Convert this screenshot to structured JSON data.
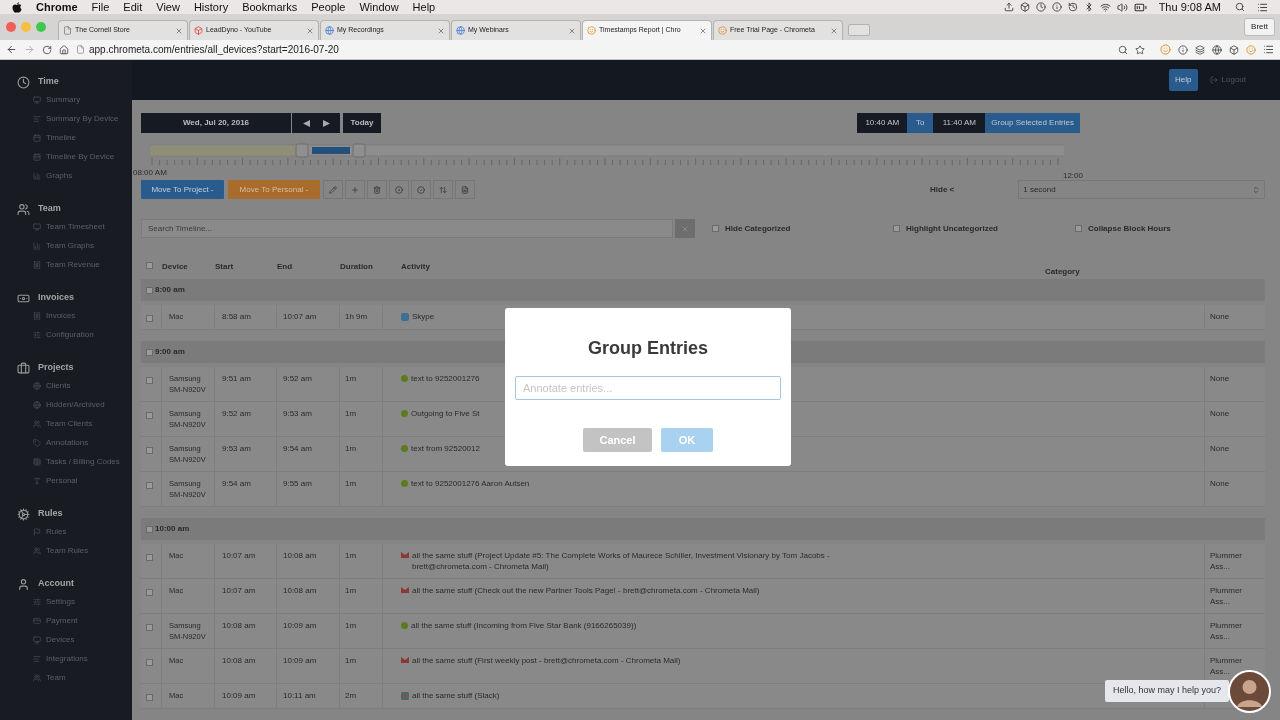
{
  "menubar": {
    "app": "Chrome",
    "menus": [
      "File",
      "Edit",
      "View",
      "History",
      "Bookmarks",
      "People",
      "Window",
      "Help"
    ],
    "clock": "Thu 9:08 AM"
  },
  "browser": {
    "tabs": [
      {
        "title": "The Cornell Store",
        "selected": false
      },
      {
        "title": "LeadDyno - YouTube",
        "selected": false
      },
      {
        "title": "My Recordings",
        "selected": false
      },
      {
        "title": "My Webinars",
        "selected": false
      },
      {
        "title": "Timestamps Report | Chro",
        "selected": true
      },
      {
        "title": "Free Trial Page - Chrometa",
        "selected": false
      }
    ],
    "profile": "Brett",
    "url": "app.chrometa.com/entries/all_devices?start=2016-07-20"
  },
  "header": {
    "help": "Help",
    "logout": "Logout"
  },
  "sidebar": [
    {
      "title": "Time",
      "items": [
        "Summary",
        "Summary By Device",
        "Timeline",
        "Timeline By Device",
        "Graphs"
      ]
    },
    {
      "title": "Team",
      "items": [
        "Team Timesheet",
        "Team Graphs",
        "Team Revenue"
      ]
    },
    {
      "title": "Invoices",
      "items": [
        "Invoices",
        "Configuration"
      ]
    },
    {
      "title": "Projects",
      "items": [
        "Clients",
        "Hidden/Archived",
        "Team Clients",
        "Annotations",
        "Tasks / Billing Codes",
        "Personal"
      ]
    },
    {
      "title": "Rules",
      "items": [
        "Rules",
        "Team Rules"
      ]
    },
    {
      "title": "Account",
      "items": [
        "Settings",
        "Payment",
        "Devices",
        "Integrations",
        "Team"
      ]
    }
  ],
  "toolbar": {
    "date": "Wed, Jul 20, 2016",
    "today": "Today",
    "from": "10:40 AM",
    "to_label": "To",
    "to": "11:40 AM",
    "group": "Group Selected Entries",
    "move_project": "Move To Project -",
    "move_personal": "Move To Personal -",
    "hide": "Hide <",
    "interval": "1 second",
    "search_placeholder": "Search Timeline...",
    "filters": [
      {
        "label": "Hide Categorized",
        "checked": false
      },
      {
        "label": "Highlight Uncategorized",
        "checked": false
      },
      {
        "label": "Collapse Block Hours",
        "checked": false
      }
    ]
  },
  "timeline": {
    "start": "08:00 AM",
    "end": "12:00"
  },
  "table": {
    "all_checked": false,
    "columns": [
      "Device",
      "Start",
      "End",
      "Duration",
      "Activity",
      "Category"
    ],
    "groups": [
      {
        "label": "8:00 am",
        "checked": false,
        "rows": [
          {
            "device": "Mac",
            "start": "8:58 am",
            "end": "10:07 am",
            "duration": "1h 9m",
            "kind": "video",
            "activity": "Skype",
            "category": "None",
            "checked": false
          }
        ]
      },
      {
        "label": "9:00 am",
        "checked": false,
        "rows": [
          {
            "device": "Samsung SM-N920V",
            "start": "9:51 am",
            "end": "9:52 am",
            "duration": "1m",
            "kind": "phone",
            "activity": "text to 9252001276",
            "category": "None",
            "checked": false
          },
          {
            "device": "Samsung SM-N920V",
            "start": "9:52 am",
            "end": "9:53 am",
            "duration": "1m",
            "kind": "phone",
            "activity": "Outgoing to Five St",
            "category": "None",
            "checked": false
          },
          {
            "device": "Samsung SM-N920V",
            "start": "9:53 am",
            "end": "9:54 am",
            "duration": "1m",
            "kind": "phone",
            "activity": "text from 92520012",
            "category": "None",
            "checked": false
          },
          {
            "device": "Samsung SM-N920V",
            "start": "9:54 am",
            "end": "9:55 am",
            "duration": "1m",
            "kind": "phone",
            "activity": "text to 9252001276 Aaron Autsen",
            "category": "None",
            "checked": false
          }
        ]
      },
      {
        "label": "10:00 am",
        "checked": false,
        "rows": [
          {
            "device": "Mac",
            "start": "10:07 am",
            "end": "10:08 am",
            "duration": "1m",
            "kind": "mail",
            "activity": "all the same stuff (Project Update #5: The Complete Works of Maurece Schiller, Investment Visionary by Tom Jacobs - brett@chrometa.com - Chrometa Mail)",
            "category": "Plummer Ass...",
            "checked": false
          },
          {
            "device": "Mac",
            "start": "10:07 am",
            "end": "10:08 am",
            "duration": "1m",
            "kind": "mail",
            "activity": "all the same stuff (Check out the new Partner Tools Page! - brett@chrometa.com - Chrometa Mail)",
            "category": "Plummer Ass...",
            "checked": false
          },
          {
            "device": "Samsung SM-N920V",
            "start": "10:08 am",
            "end": "10:09 am",
            "duration": "1m",
            "kind": "phone",
            "activity": "all the same stuff (Incoming from Five Star Bank (9166265039))",
            "category": "Plummer Ass...",
            "checked": false
          },
          {
            "device": "Mac",
            "start": "10:08 am",
            "end": "10:09 am",
            "duration": "1m",
            "kind": "mail",
            "activity": "all the same stuff (First weekly post - brett@chrometa.com - Chrometa Mail)",
            "category": "Plummer Ass...",
            "checked": false
          },
          {
            "device": "Mac",
            "start": "10:09 am",
            "end": "10:11 am",
            "duration": "2m",
            "kind": "chat",
            "activity": "all the same stuff (Slack)",
            "checked": false
          }
        ]
      }
    ]
  },
  "modal": {
    "title": "Group Entries",
    "placeholder": "Annotate entries...",
    "buttons": [
      {
        "label": "Cancel",
        "kind": "cancel",
        "disabled": false
      },
      {
        "label": "OK",
        "kind": "ok",
        "disabled": true
      }
    ]
  },
  "chat": {
    "message": "Hello, how may I help you?"
  }
}
